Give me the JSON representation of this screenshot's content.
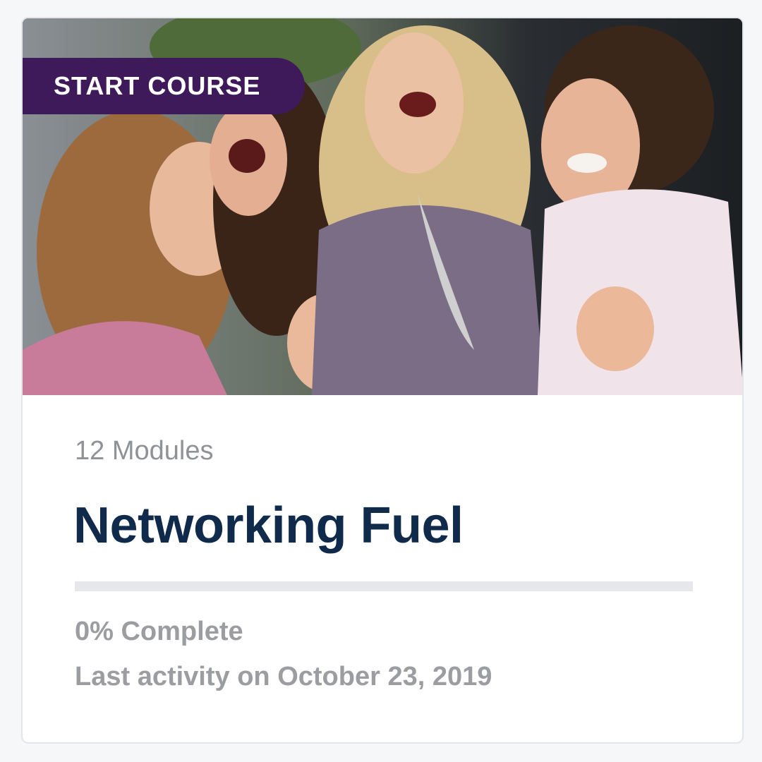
{
  "course": {
    "badge_label": "START COURSE",
    "modules_label": "12 Modules",
    "title": "Networking Fuel",
    "progress_fraction": 0,
    "complete_label": "0% Complete",
    "last_activity": "Last activity on October 23, 2019",
    "image_subject": "four-women-laughing-photo"
  },
  "colors": {
    "badge_bg": "#3f1a5b",
    "title": "#0f2a4a",
    "muted_text": "#9b9da1",
    "track": "#e6e7eb"
  }
}
